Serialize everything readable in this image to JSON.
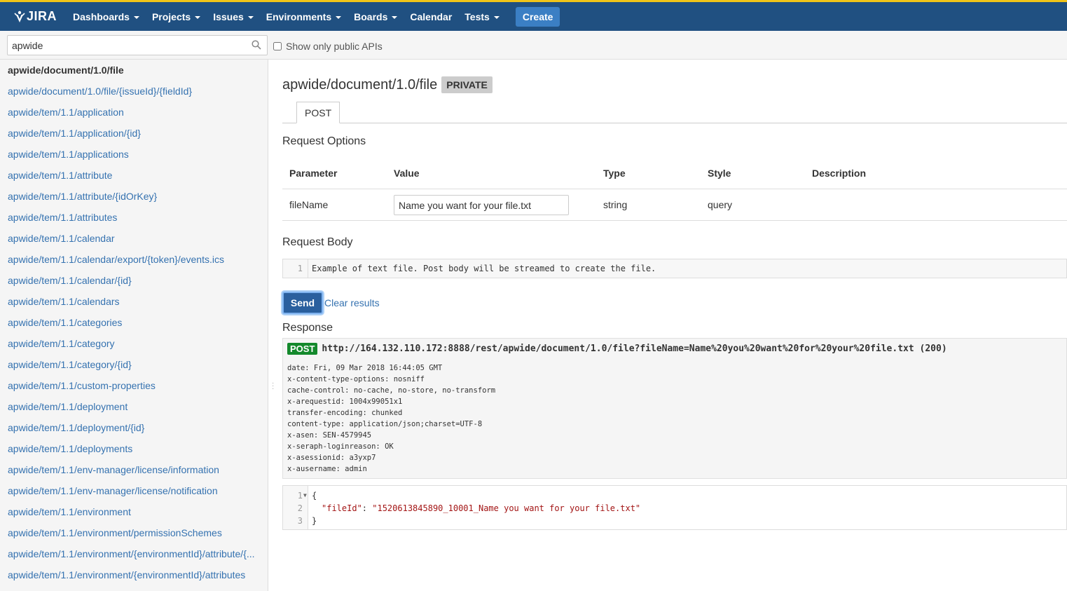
{
  "nav": {
    "logo_text": "JIRA",
    "items": [
      {
        "label": "Dashboards",
        "dropdown": true
      },
      {
        "label": "Projects",
        "dropdown": true
      },
      {
        "label": "Issues",
        "dropdown": true
      },
      {
        "label": "Environments",
        "dropdown": true
      },
      {
        "label": "Boards",
        "dropdown": true
      },
      {
        "label": "Calendar",
        "dropdown": false
      },
      {
        "label": "Tests",
        "dropdown": true
      }
    ],
    "create_label": "Create"
  },
  "filter": {
    "search_value": "apwide",
    "public_only_label": "Show only public APIs"
  },
  "sidebar": {
    "items": [
      "apwide/document/1.0/file",
      "apwide/document/1.0/file/{issueId}/{fieldId}",
      "apwide/tem/1.1/application",
      "apwide/tem/1.1/application/{id}",
      "apwide/tem/1.1/applications",
      "apwide/tem/1.1/attribute",
      "apwide/tem/1.1/attribute/{idOrKey}",
      "apwide/tem/1.1/attributes",
      "apwide/tem/1.1/calendar",
      "apwide/tem/1.1/calendar/export/{token}/events.ics",
      "apwide/tem/1.1/calendar/{id}",
      "apwide/tem/1.1/calendars",
      "apwide/tem/1.1/categories",
      "apwide/tem/1.1/category",
      "apwide/tem/1.1/category/{id}",
      "apwide/tem/1.1/custom-properties",
      "apwide/tem/1.1/deployment",
      "apwide/tem/1.1/deployment/{id}",
      "apwide/tem/1.1/deployments",
      "apwide/tem/1.1/env-manager/license/information",
      "apwide/tem/1.1/env-manager/license/notification",
      "apwide/tem/1.1/environment",
      "apwide/tem/1.1/environment/permissionSchemes",
      "apwide/tem/1.1/environment/{environmentId}/attribute/{...",
      "apwide/tem/1.1/environment/{environmentId}/attributes"
    ]
  },
  "main": {
    "title": "apwide/document/1.0/file",
    "badge": "PRIVATE",
    "tab": "POST",
    "request_options_title": "Request Options",
    "columns": [
      "Parameter",
      "Value",
      "Type",
      "Style",
      "Description"
    ],
    "param": {
      "name": "fileName",
      "value": "Name you want for your file.txt",
      "type": "string",
      "style": "query",
      "description": ""
    },
    "request_body_title": "Request Body",
    "body_line_number": "1",
    "body_text": "Example of text file. Post body will be streamed to create the file.",
    "send_label": "Send",
    "clear_label": "Clear results",
    "response_title": "Response",
    "response": {
      "method": "POST",
      "url": "http://164.132.110.172:8888/rest/apwide/document/1.0/file?fileName=Name%20you%20want%20for%20your%20file.txt (200)",
      "headers": [
        "date: Fri, 09 Mar 2018 16:44:05 GMT",
        "x-content-type-options: nosniff",
        "cache-control: no-cache, no-store, no-transform",
        "x-arequestid: 1004x99051x1",
        "transfer-encoding: chunked",
        "content-type: application/json;charset=UTF-8",
        "x-asen: SEN-4579945",
        "x-seraph-loginreason: OK",
        "x-asessionid: a3yxp7",
        "x-ausername: admin"
      ],
      "json_lines": [
        {
          "num": "1",
          "text": "{"
        },
        {
          "num": "2",
          "key": "\"fileId\"",
          "value": "\"1520613845890_10001_Name you want for your file.txt\""
        },
        {
          "num": "3",
          "text": "}"
        }
      ]
    }
  },
  "colors": {
    "topbar": "#205081",
    "accent_stripe": "#f0c419",
    "link": "#3572b0",
    "post_badge": "#14892c",
    "send_button": "#2a5f9e"
  }
}
